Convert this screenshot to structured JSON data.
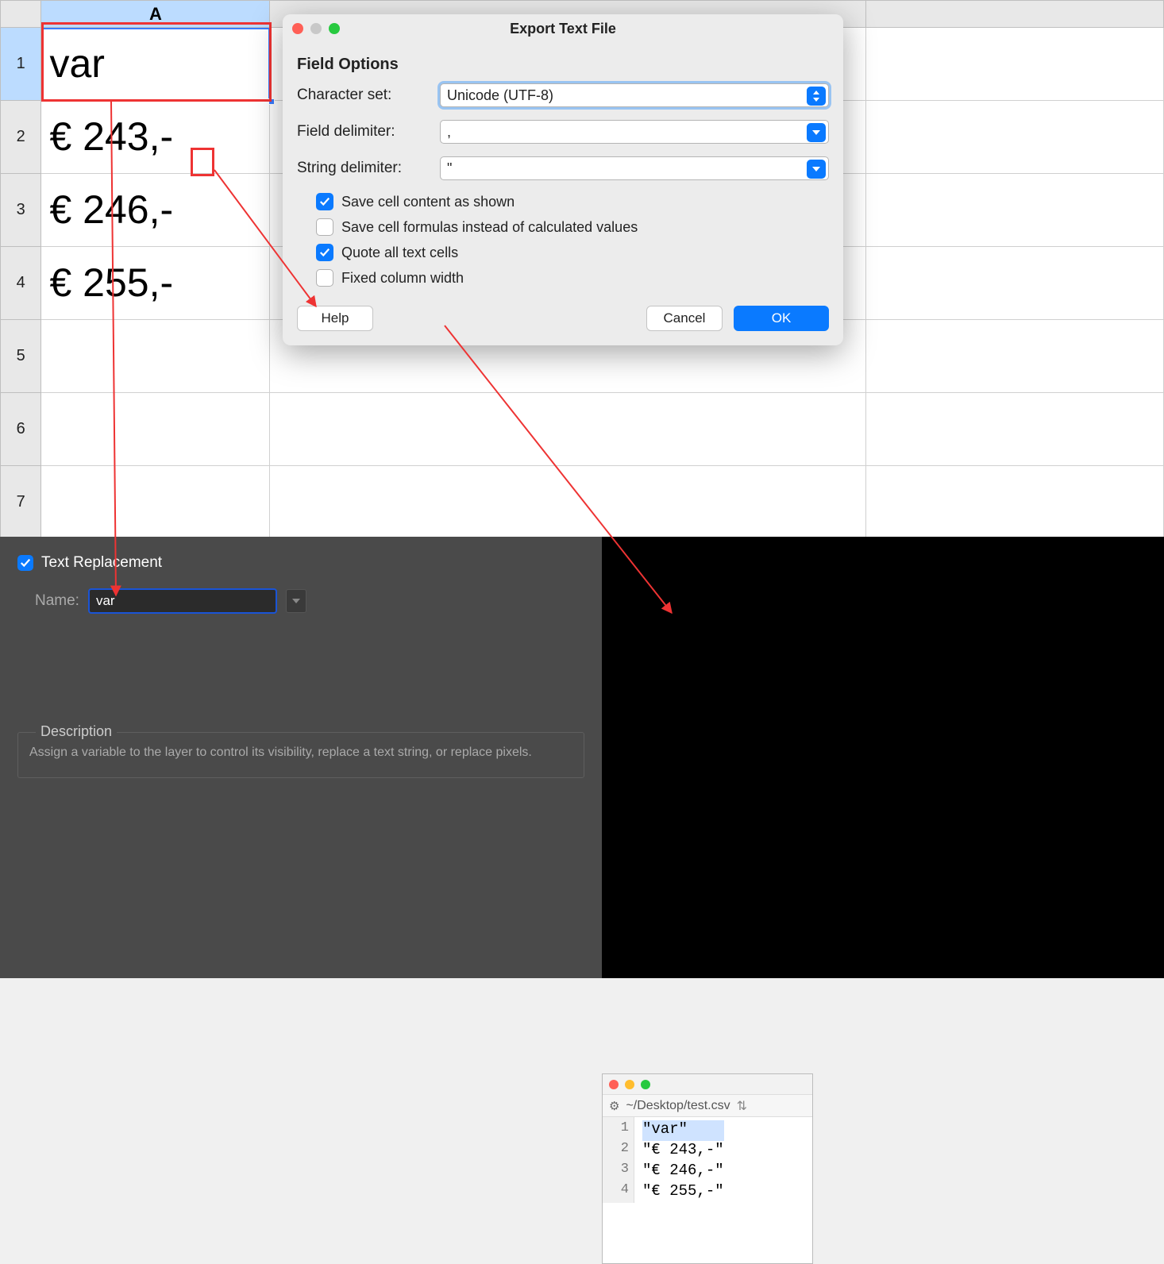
{
  "spreadsheet": {
    "col_header": "A",
    "rows": [
      "1",
      "2",
      "3",
      "4",
      "5",
      "6",
      "7"
    ],
    "cells": [
      "var",
      "€ 243,-",
      "€ 246,-",
      "€ 255,-",
      "",
      "",
      ""
    ]
  },
  "dialog": {
    "title": "Export Text File",
    "section": "Field Options",
    "charset_label": "Character set:",
    "charset_value": "Unicode (UTF-8)",
    "field_delim_label": "Field delimiter:",
    "field_delim_value": ",",
    "string_delim_label": "String delimiter:",
    "string_delim_value": "\"",
    "opt_save_shown": "Save cell content as shown",
    "opt_save_formulas": "Save cell formulas instead of calculated values",
    "opt_quote_all": "Quote all text cells",
    "opt_fixed_width": "Fixed column width",
    "help": "Help",
    "cancel": "Cancel",
    "ok": "OK"
  },
  "inspector": {
    "text_replacement": "Text Replacement",
    "name_label": "Name:",
    "name_value": "var",
    "desc_title": "Description",
    "desc_text": "Assign a variable to the layer to control its visibility, replace a text string, or replace pixels."
  },
  "editor": {
    "path": "~/Desktop/test.csv",
    "line_numbers": [
      "1",
      "2",
      "3",
      "4"
    ],
    "lines": [
      "\"var\"",
      "\"€ 243,-\"",
      "\"€ 246,-\"",
      "\"€ 255,-\""
    ]
  }
}
